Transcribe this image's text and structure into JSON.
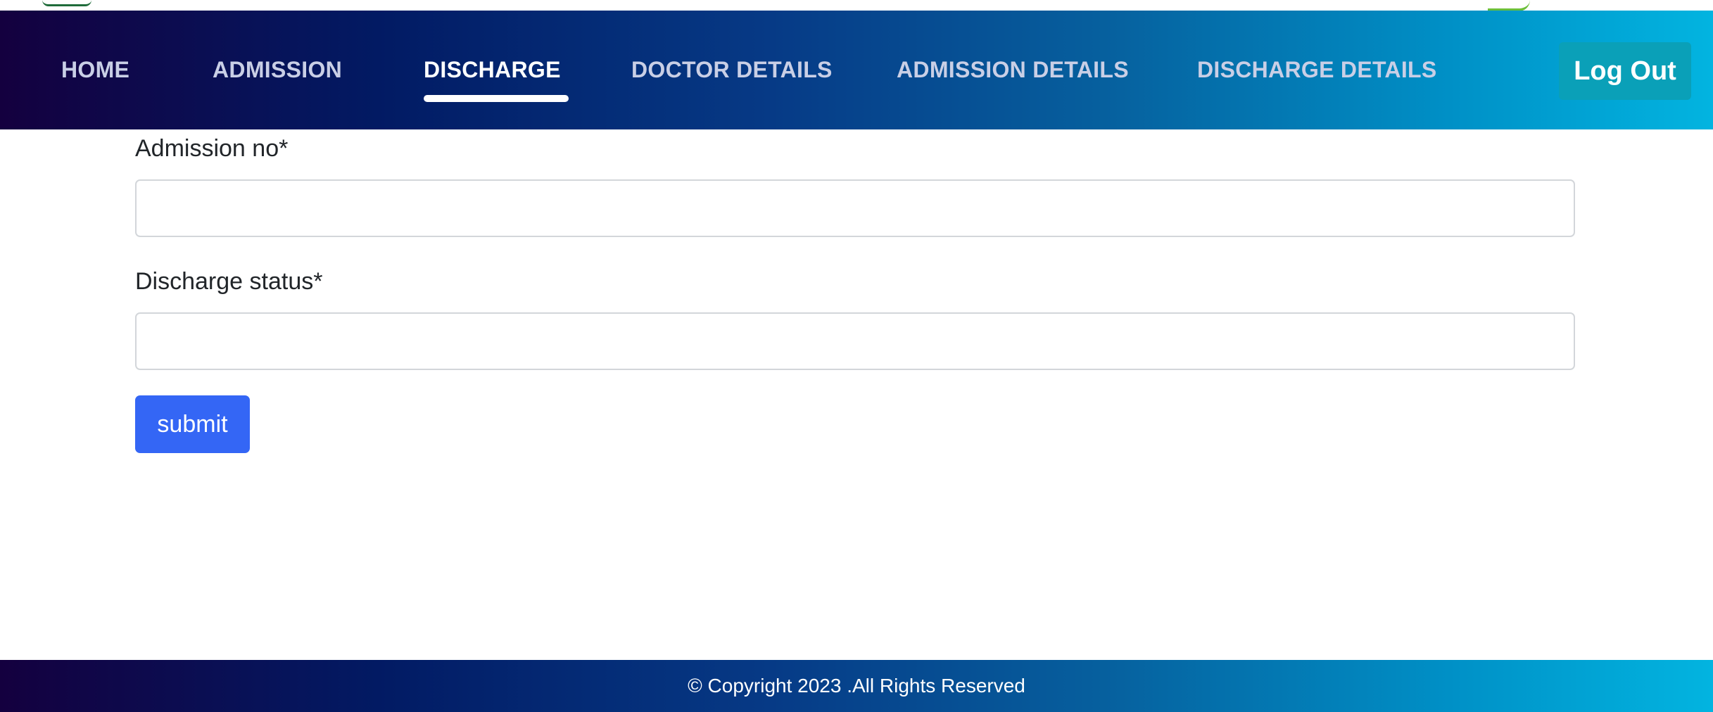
{
  "nav": {
    "items": [
      {
        "label": "HOME"
      },
      {
        "label": "ADMISSION"
      },
      {
        "label": "DISCHARGE",
        "active": true
      },
      {
        "label": "DOCTOR DETAILS"
      },
      {
        "label": "ADMISSION DETAILS"
      },
      {
        "label": "DISCHARGE DETAILS"
      }
    ],
    "logout_label": "Log Out"
  },
  "form": {
    "admission_no": {
      "label": "Admission no*",
      "value": "",
      "placeholder": ""
    },
    "discharge_status": {
      "label": "Discharge status*",
      "value": "",
      "placeholder": ""
    },
    "submit_label": "submit"
  },
  "footer": {
    "text": "© Copyright 2023 .All Rights Reserved"
  },
  "colors": {
    "nav_gradient_start": "#14003f",
    "nav_gradient_end": "#02b4e0",
    "logout_button": "#0aa0b8",
    "submit_button": "#3466f5"
  }
}
